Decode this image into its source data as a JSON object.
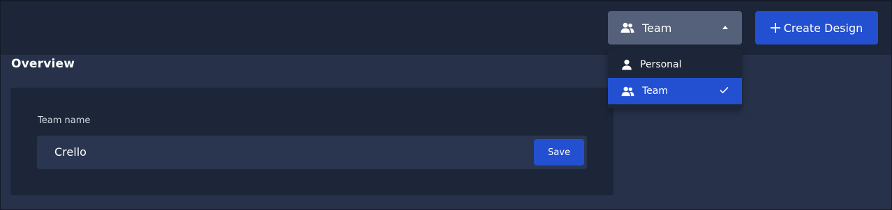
{
  "header": {
    "workspace_select": {
      "selected": "Team",
      "icon": "users-icon"
    },
    "create_design_button": {
      "icon": "plus-icon",
      "label": "Create Design"
    }
  },
  "workspace_menu": {
    "items": [
      {
        "label": "Personal",
        "icon": "user-icon",
        "selected": false
      },
      {
        "label": "Team",
        "icon": "users-icon",
        "selected": true
      }
    ]
  },
  "main": {
    "section_title": "Overview",
    "team_name_label": "Team name",
    "team_name_value": "Crello",
    "save_label": "Save"
  },
  "colors": {
    "page_bg": "#27324a",
    "topbar_bg": "#1d2639",
    "accent": "#2350d1",
    "select_bg": "#55607a"
  }
}
